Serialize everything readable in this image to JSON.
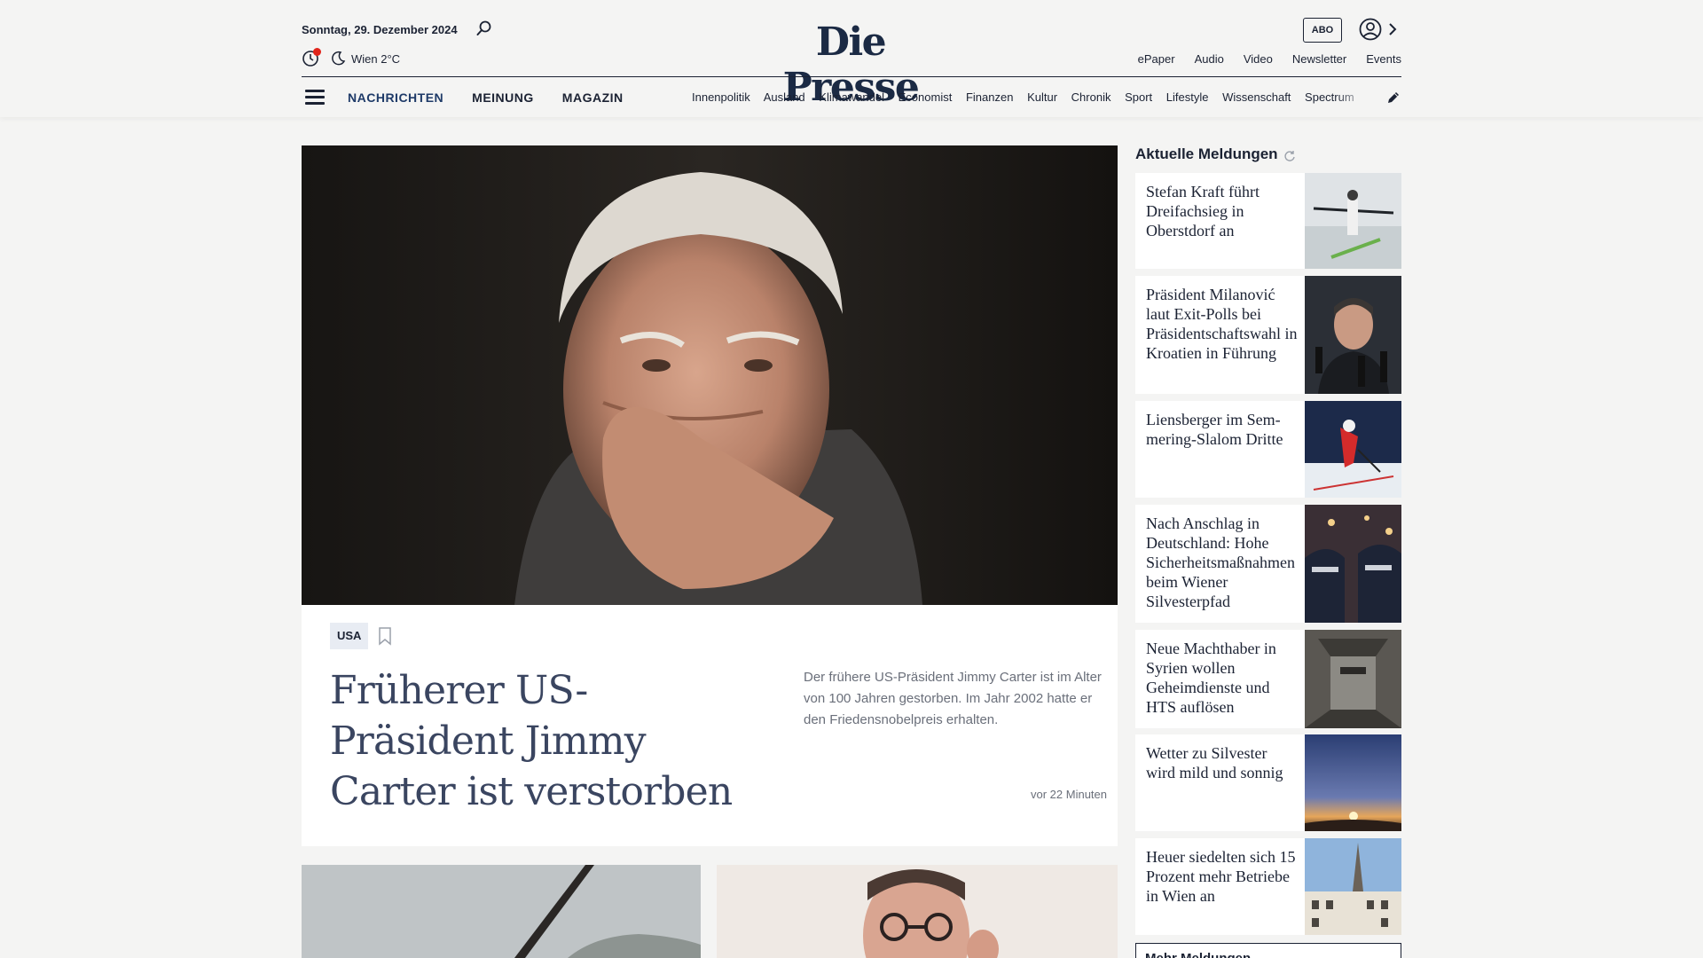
{
  "header": {
    "date": "Sonntag, 29. Dezember 2024",
    "weather": "Wien 2°C",
    "logo": "Die Presse",
    "abo_label": "ABO",
    "top_links": [
      "ePaper",
      "Audio",
      "Video",
      "Newsletter",
      "Events"
    ],
    "main_nav": [
      "NACHRICHTEN",
      "MEINUNG",
      "MAGAZIN"
    ],
    "sub_nav": [
      "Innenpolitik",
      "Ausland",
      "Klimawandel",
      "Economist",
      "Finanzen",
      "Kultur",
      "Chronik",
      "Sport",
      "Lifestyle",
      "Wissenschaft",
      "Spectrum"
    ]
  },
  "hero": {
    "category": "USA",
    "title": "Früherer US-Präsident Jimmy Carter ist verstorben",
    "lead": "Der frühere US-Präsident Jimmy Carter ist im Alter von 100 Jahren gestorben. Im Jahr 2002 hatte er den Friedensnobelpreis erhalten.",
    "time": "vor 22 Minuten"
  },
  "sidebar": {
    "heading": "Aktuelle Meldungen",
    "items": [
      {
        "title": "Stefan Kraft führt Dreifachsieg in Oberstdorf an"
      },
      {
        "title": "Präsident Milanović laut Exit-Polls bei Präsidentschaftswahl in Kroatien in Führung"
      },
      {
        "title": "Liensberger im Sem­mering-Slalom Dritte"
      },
      {
        "title": "Nach Anschlag in Deutschland: Hohe Sicherheits­maßnahmen beim Wiener Silvesterpfad"
      },
      {
        "title": "Neue Machthaber in Syrien wollen Geheimdienste und HTS auflösen"
      },
      {
        "title": "Wetter zu Silvester wird mild und sonnig"
      },
      {
        "title": "Heuer siedelten sich 15 Prozent mehr Betriebe in Wien an"
      }
    ],
    "more_label": "Mehr Meldungen"
  },
  "colors": {
    "brand_navy": "#1b2a44",
    "page_bg": "#f4f4f3",
    "accent_red": "#e1251b",
    "category_bg": "#e8ecf3"
  }
}
